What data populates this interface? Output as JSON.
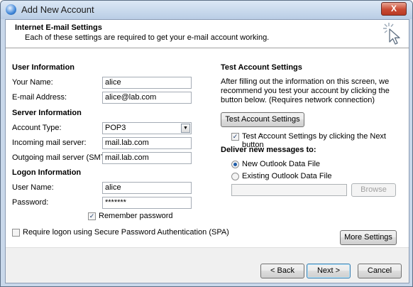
{
  "window": {
    "title": "Add New Account",
    "close_label": "X"
  },
  "header": {
    "title": "Internet E-mail Settings",
    "subtitle": "Each of these settings are required to get your e-mail account working."
  },
  "user_info": {
    "heading": "User Information",
    "name_label": "Your Name:",
    "name_value": "alice",
    "email_label": "E-mail Address:",
    "email_value": "alice@lab.com"
  },
  "server_info": {
    "heading": "Server Information",
    "account_type_label": "Account Type:",
    "account_type_value": "POP3",
    "incoming_label": "Incoming mail server:",
    "incoming_value": "mail.lab.com",
    "outgoing_label": "Outgoing mail server (SMTP):",
    "outgoing_value": "mail.lab.com"
  },
  "logon_info": {
    "heading": "Logon Information",
    "username_label": "User Name:",
    "username_value": "alice",
    "password_label": "Password:",
    "password_value": "*******",
    "remember_label": "Remember password",
    "remember_checked": true,
    "spa_label": "Require logon using Secure Password Authentication (SPA)",
    "spa_checked": false
  },
  "test_settings": {
    "heading": "Test Account Settings",
    "description": "After filling out the information on this screen, we recommend you test your account by clicking the button below. (Requires network connection)",
    "test_button": "Test Account Settings ...",
    "test_next_label": "Test Account Settings by clicking the Next button",
    "test_next_checked": true
  },
  "deliver": {
    "heading": "Deliver new messages to:",
    "new_file_label": "New Outlook Data File",
    "existing_file_label": "Existing Outlook Data File",
    "selected": "new",
    "browse_button": "Browse"
  },
  "more_settings_button": "More Settings ...",
  "footer": {
    "back": "< Back",
    "next": "Next >",
    "cancel": "Cancel"
  }
}
